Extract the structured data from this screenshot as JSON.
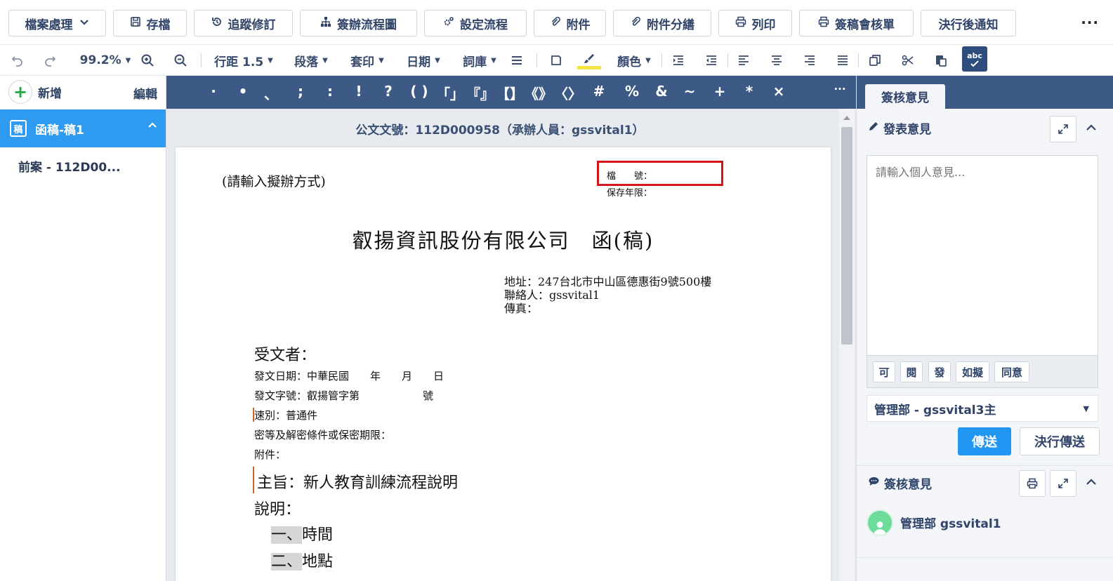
{
  "toolbar": {
    "file_menu": "檔案處理",
    "save": "存檔",
    "track_changes": "追蹤修訂",
    "flow_chart": "簽辦流程圖",
    "set_flow": "設定流程",
    "attachment": "附件",
    "attachment_split": "附件分繕",
    "print": "列印",
    "print_review": "簽稿會核單",
    "notify_after": "決行後通知",
    "more": "···"
  },
  "format_bar": {
    "zoom": "99.2%",
    "line_spacing": "行距 1.5",
    "paragraph": "段落",
    "mail_merge": "套印",
    "date": "日期",
    "phrase_bank": "詞庫",
    "color": "顏色",
    "spell_label": "abc"
  },
  "left_panel": {
    "add": "新增",
    "edit": "編輯",
    "doc_icon": "稿",
    "current_doc": "函稿-稿1",
    "prev_case": "前案 - 112D00..."
  },
  "symbols": [
    "·",
    "•",
    "、",
    ";",
    ":",
    "!",
    "?",
    "( )",
    "「」",
    "『』",
    "【】",
    "《》",
    "〈〉",
    "#",
    "%",
    "&",
    "~",
    "+",
    "*",
    "×"
  ],
  "symbols_more": "···",
  "editor": {
    "doc_number_line": "公文文號：112D000958（承辦人員：gssvital1）",
    "dispose_hint": "(請輸入擬辦方式)",
    "file_number": "檔　　號：",
    "retention": "保存年限：",
    "company_title": "叡揚資訊股份有限公司　函(稿)",
    "address": "地址：247台北市中山區德惠街9號500樓",
    "contact": "聯絡人：gssvital1",
    "fax": "傳真：",
    "recipient": "受文者：",
    "issue_date": "發文日期：中華民國　　年　　月　　日",
    "issue_serial": "發文字號：叡揚管字第　　　　　　號",
    "speed": "速別：普通件",
    "secrecy": "密等及解密條件或保密期限：",
    "attachments": "附件：",
    "subject": "主旨：新人教育訓練流程說明",
    "explanation": "說明：",
    "items": [
      {
        "num": "一、",
        "text": "時間"
      },
      {
        "num": "二、",
        "text": "地點"
      }
    ]
  },
  "right_panel": {
    "tab": "簽核意見",
    "post_opinion": "發表意見",
    "opinion_placeholder": "請輸入個人意見...",
    "quick_phrases": [
      "可",
      "閱",
      "發",
      "如擬",
      "同意"
    ],
    "department": "管理部 - gssvital3主",
    "send": "傳送",
    "final_send": "決行傳送",
    "review_opinions": "簽核意見",
    "reviewer": "管理部 gssvital1"
  },
  "colors": {
    "header_blue": "#3d5a87",
    "active_blue": "#2e9bf0",
    "send_blue": "#2196f3",
    "highlight_red": "#d1161b"
  }
}
